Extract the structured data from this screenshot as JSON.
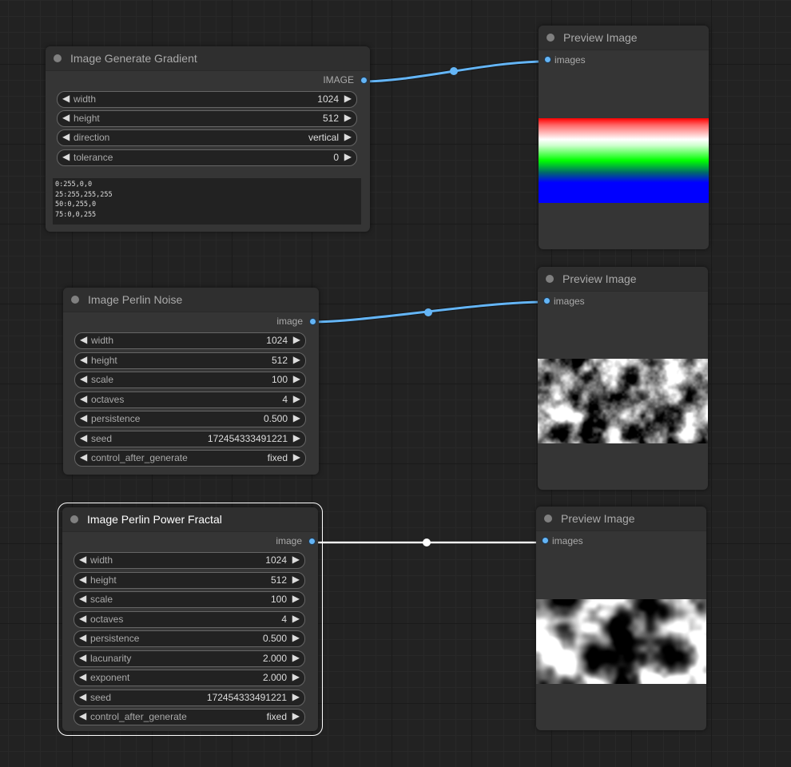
{
  "gradient_node": {
    "title": "Image Generate Gradient",
    "output_label": "IMAGE",
    "widgets": [
      {
        "name": "width",
        "value": "1024"
      },
      {
        "name": "height",
        "value": "512"
      },
      {
        "name": "direction",
        "value": "vertical"
      },
      {
        "name": "tolerance",
        "value": "0"
      }
    ],
    "gradient_stops": [
      "0:255,0,0",
      "25:255,255,255",
      "50:0,255,0",
      "75:0,0,255"
    ]
  },
  "perlin_node": {
    "title": "Image Perlin Noise",
    "output_label": "image",
    "widgets": [
      {
        "name": "width",
        "value": "1024"
      },
      {
        "name": "height",
        "value": "512"
      },
      {
        "name": "scale",
        "value": "100"
      },
      {
        "name": "octaves",
        "value": "4"
      },
      {
        "name": "persistence",
        "value": "0.500"
      },
      {
        "name": "seed",
        "value": "172454333491221"
      },
      {
        "name": "control_after_generate",
        "value": "fixed"
      }
    ]
  },
  "fractal_node": {
    "title": "Image Perlin Power Fractal",
    "output_label": "image",
    "widgets": [
      {
        "name": "width",
        "value": "1024"
      },
      {
        "name": "height",
        "value": "512"
      },
      {
        "name": "scale",
        "value": "100"
      },
      {
        "name": "octaves",
        "value": "4"
      },
      {
        "name": "persistence",
        "value": "0.500"
      },
      {
        "name": "lacunarity",
        "value": "2.000"
      },
      {
        "name": "exponent",
        "value": "2.000"
      },
      {
        "name": "seed",
        "value": "172454333491221"
      },
      {
        "name": "control_after_generate",
        "value": "fixed"
      }
    ]
  },
  "preview_nodes": [
    {
      "title": "Preview Image",
      "input_label": "images"
    },
    {
      "title": "Preview Image",
      "input_label": "images"
    },
    {
      "title": "Preview Image",
      "input_label": "images"
    }
  ],
  "icons": {
    "decrement": "triangle-left-icon",
    "increment": "triangle-right-icon"
  },
  "colors": {
    "link": "#64b5f6",
    "selected_link": "#ffffff",
    "slot": "#64b5f6"
  }
}
